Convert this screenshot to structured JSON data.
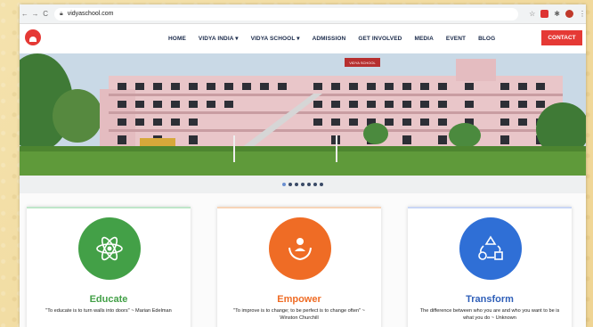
{
  "browser": {
    "url": "vidyaschool.com"
  },
  "header": {
    "menu": [
      {
        "label": "HOME"
      },
      {
        "label": "VIDYA INDIA ▾"
      },
      {
        "label": "VIDYA SCHOOL ▾"
      },
      {
        "label": "ADMISSION"
      },
      {
        "label": "GET INVOLVED"
      },
      {
        "label": "MEDIA"
      },
      {
        "label": "EVENT"
      },
      {
        "label": "BLOG"
      }
    ],
    "contact_label": "CONTACT"
  },
  "hero": {
    "building_sign": "VIDYA SCHOOL",
    "dots_count": 7
  },
  "cards": [
    {
      "title": "Educate",
      "color": "#43a047",
      "title_color": "#43a047",
      "icon": "atom-icon",
      "text": "\"To educate is to turn walls into doors\" ~ Marian Edelman"
    },
    {
      "title": "Empower",
      "color": "#ef6c25",
      "title_color": "#ef6c25",
      "icon": "hands-person-icon",
      "text": "\"To improve is to change; to be perfect is to change often\" ~ Winston Churchill"
    },
    {
      "title": "Transform",
      "color": "#2f6fd6",
      "title_color": "#2f5fb8",
      "icon": "shapes-cycle-icon",
      "text": "The difference between who you are and who you want to be is what you do ~ Unknown"
    }
  ]
}
